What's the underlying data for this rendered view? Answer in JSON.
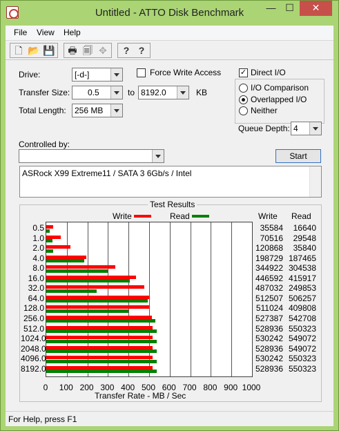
{
  "window": {
    "title": "Untitled - ATTO Disk Benchmark",
    "min": "—",
    "max": "☐",
    "close": "✕"
  },
  "menu": [
    "File",
    "View",
    "Help"
  ],
  "toolbar": {
    "new": "🗋",
    "open": "📂",
    "save": "💾",
    "print": "🖶",
    "preview": "🗐",
    "move": "✥",
    "help": "?",
    "whatsthis": "?"
  },
  "settings": {
    "drive_label": "Drive:",
    "drive_value": "[-d-]",
    "force_write_label": "Force Write Access",
    "force_write_checked": false,
    "direct_io_label": "Direct I/O",
    "direct_io_checked": true,
    "direct_io_mark": "✓",
    "transfer_size_label": "Transfer Size:",
    "transfer_from": "0.5",
    "to_label": "to",
    "transfer_to": "8192.0",
    "kb_label": "KB",
    "total_length_label": "Total Length:",
    "total_length": "256 MB",
    "io_comparison_label": "I/O Comparison",
    "overlapped_io_label": "Overlapped I/O",
    "neither_label": "Neither",
    "io_mode": "Overlapped I/O",
    "queue_depth_label": "Queue Depth:",
    "queue_depth": "4",
    "controlled_by_label": "Controlled by:",
    "controlled_by_value": "",
    "start_label": "Start"
  },
  "description": "ASRock X99 Extreme11 / SATA 3 6Gb/s / Intel",
  "results": {
    "title": "Test Results",
    "write_legend": "Write",
    "read_legend": "Read",
    "write_col": "Write",
    "read_col": "Read",
    "xaxis_label": "Transfer Rate - MB / Sec",
    "colors": {
      "write": "#ff0000",
      "read": "#008000"
    }
  },
  "chart_data": {
    "type": "bar",
    "orientation": "horizontal",
    "title": "Test Results",
    "xlabel": "Transfer Rate - MB / Sec",
    "xlim": [
      0,
      1000
    ],
    "xticks": [
      0,
      100,
      200,
      300,
      400,
      500,
      600,
      700,
      800,
      900,
      1000
    ],
    "grid": true,
    "legend": "top",
    "categories": [
      "0.5",
      "1.0",
      "2.0",
      "4.0",
      "8.0",
      "16.0",
      "32.0",
      "64.0",
      "128.0",
      "256.0",
      "512.0",
      "1024.0",
      "2048.0",
      "4096.0",
      "8192.0"
    ],
    "series": [
      {
        "name": "Write",
        "color": "#ff0000",
        "values": [
          35584,
          70516,
          120868,
          198729,
          344922,
          446592,
          487032,
          512507,
          511024,
          527387,
          528936,
          530242,
          528936,
          530242,
          528936
        ]
      },
      {
        "name": "Read",
        "color": "#008000",
        "values": [
          16640,
          29548,
          35840,
          187465,
          304538,
          415917,
          249853,
          506257,
          409808,
          542708,
          550323,
          549072,
          549072,
          550323,
          550323
        ]
      }
    ]
  },
  "status": "For Help, press F1"
}
